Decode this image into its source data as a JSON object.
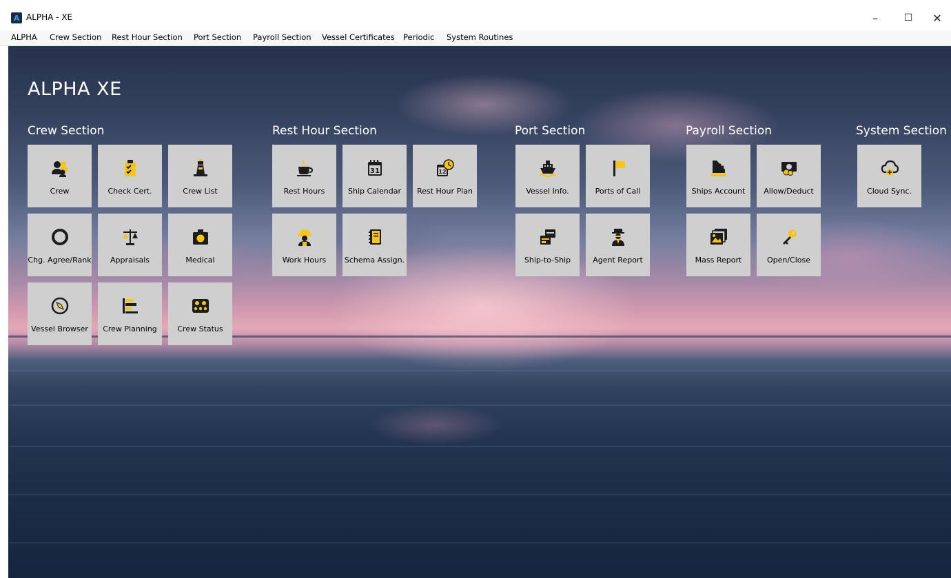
{
  "window": {
    "title": "ALPHA - XE",
    "minimize": "–",
    "maximize": "☐",
    "close": "✕"
  },
  "menu": [
    "ALPHA",
    "Crew Section",
    "Rest Hour Section",
    "Port Section",
    "Payroll Section",
    "Vessel Certificates",
    "Periodic",
    "System Routines"
  ],
  "brand": "ALPHA XE",
  "sections": {
    "crew": "Crew Section",
    "rest_hour": "Rest Hour Section",
    "port": "Port Section",
    "payroll": "Payroll Section",
    "system": "System Section"
  },
  "tiles": {
    "crew": "Crew",
    "check_cert": "Check Cert.",
    "crew_list": "Crew List",
    "chg_agree_rank": "Chg. Agree/Rank",
    "appraisals": "Appraisals",
    "medical": "Medical",
    "vessel_browser": "Vessel Browser",
    "crew_planning": "Crew Planning",
    "crew_status": "Crew Status",
    "rest_hours": "Rest Hours",
    "ship_calendar": "Ship Calendar",
    "rest_hour_plan": "Rest Hour Plan",
    "work_hours": "Work Hours",
    "schema_assign": "Schema Assign.",
    "vessel_info": "Vessel Info.",
    "ports_of_call": "Ports of Call",
    "ship_to_ship": "Ship-to-Ship",
    "agent_report": "Agent Report",
    "ships_account": "Ships Account",
    "allow_deduct": "Allow/Deduct",
    "mass_report": "Mass Report",
    "open_close": "Open/Close",
    "cloud_sync": "Cloud Sync."
  },
  "icon_text": {
    "calendar_day": "31",
    "plan_day": "12"
  },
  "colors": {
    "tile_bg": "#cfcfcf",
    "icon_dark": "#1c1c1c",
    "icon_accent": "#f5c518"
  }
}
